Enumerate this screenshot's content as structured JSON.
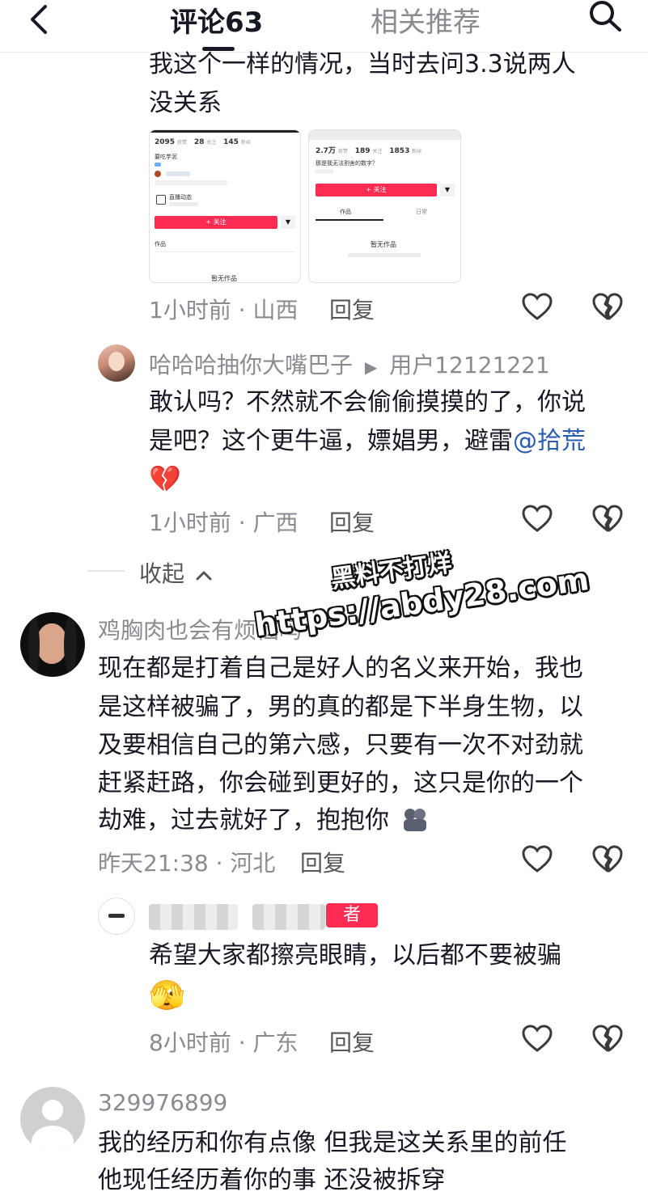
{
  "header": {
    "tab_comments": "评论63",
    "tab_related": "相关推荐"
  },
  "comment1": {
    "text_line1": "我这个一样的情况，当时去问3.3说两人",
    "text_line2": "没关系",
    "meta": "1小时前 · 山西",
    "reply_label": "回复",
    "screenshot_left": {
      "stat1_num": "2095",
      "stat1_label": "获赞",
      "stat2_num": "28",
      "stat2_label": "关注",
      "stat3_num": "145",
      "stat3_label": "粉丝",
      "bio": "要吃芋泥",
      "live_label": "直播动态",
      "follow_label": "+ 关注",
      "works_label": "作品",
      "empty_label": "暂无作品"
    },
    "screenshot_right": {
      "stat1_num": "2.7万",
      "stat1_label": "获赞",
      "stat2_num": "189",
      "stat2_label": "关注",
      "stat3_num": "1853",
      "stat3_label": "粉丝",
      "bio": "那是我无法割舍的数字？",
      "follow_label": "+ 关注",
      "tab1": "作品",
      "tab2": "日常",
      "empty_label": "暂无作品"
    }
  },
  "reply1": {
    "author": "哈哈哈抽你大嘴巴子",
    "arrow": "▶",
    "reply_to": "用户12121221",
    "text_line1": "敢认吗？不然就不会偷偷摸摸的了，你说",
    "text_line2_prefix": "是吧？这个更牛逼，嫖娼男，避雷",
    "mention": "@拾荒",
    "emoji": "💔",
    "meta": "1小时前 · 广西",
    "reply_label": "回复"
  },
  "collapse": {
    "label": "收起"
  },
  "watermark": {
    "line1": "黑料不打烊",
    "line2": "https://abdy28.com"
  },
  "comment2": {
    "author": "鸡胸肉也会有烦恼吗",
    "text_lines": [
      "现在都是打着自己是好人的名义来开始，我也",
      "是这样被骗了，男的真的都是下半身生物，以",
      "及要相信自己的第六感，只要有一次不对劲就",
      "赶紧赶路，你会碰到更好的，这只是你的一个",
      "劫难，过去就好了，抱抱你"
    ],
    "meta": "昨天21:38 · 河北",
    "reply_label": "回复"
  },
  "reply2": {
    "badge": "者",
    "text_line1": "希望大家都擦亮眼睛，以后都不要被骗",
    "emoji": "🫣",
    "meta": "8小时前 · 广东",
    "reply_label": "回复"
  },
  "comment3": {
    "author": "329976899",
    "text_line1": "我的经历和你有点像 但我是这关系里的前任",
    "text_line2": "他现任经历着你的事 还没被拆穿"
  },
  "colors": {
    "accent": "#fe2c55",
    "meta_gray": "#8a8b91",
    "mention_blue": "#2a5db0"
  }
}
